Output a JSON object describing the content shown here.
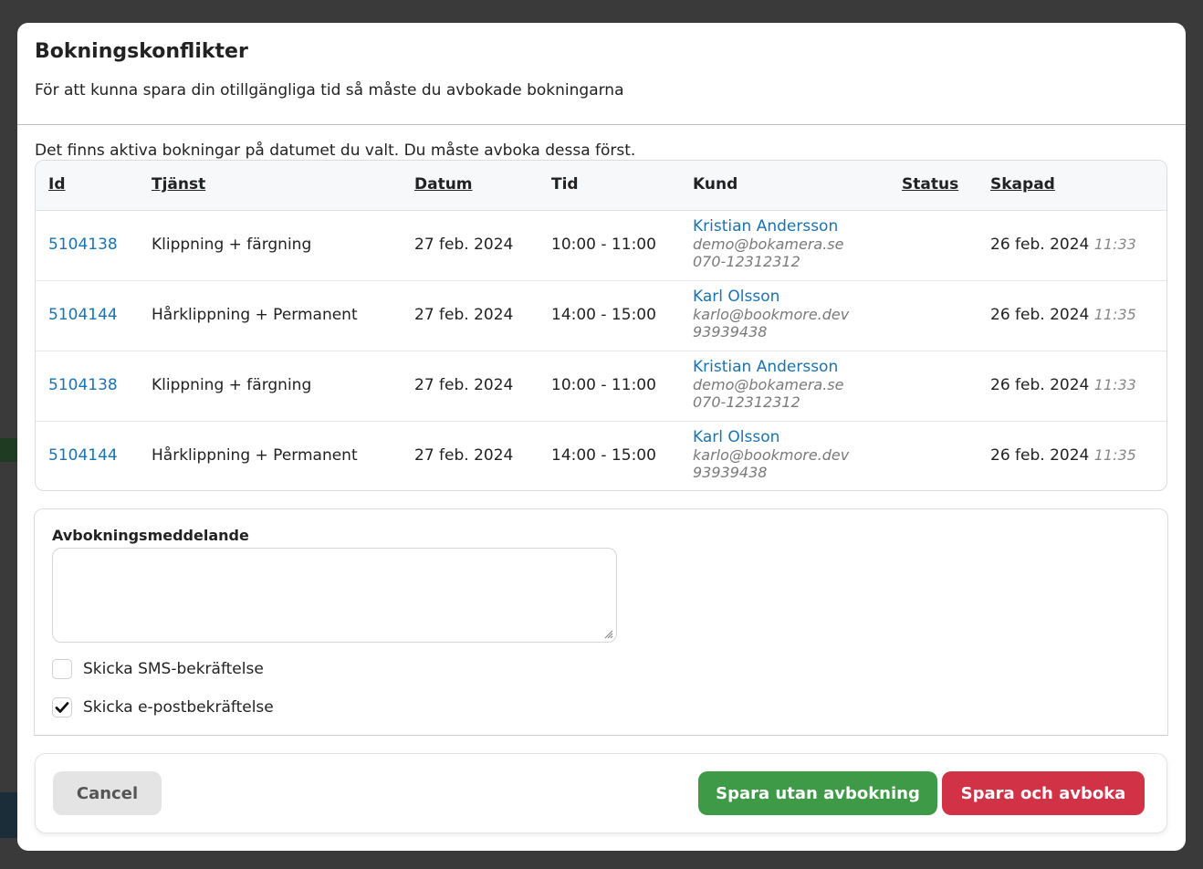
{
  "modal": {
    "title": "Bokningskonflikter",
    "subtitle": "För att kunna spara din otillgängliga tid så måste du avbokade bokningarna",
    "notice": "Det finns aktiva bokningar på datumet du valt. Du måste avboka dessa först."
  },
  "table": {
    "headers": {
      "id": "Id",
      "service": "Tjänst",
      "date": "Datum",
      "time": "Tid",
      "customer": "Kund",
      "status": "Status",
      "created": "Skapad"
    },
    "rows": [
      {
        "id": "5104138",
        "service": "Klippning + färgning",
        "date": "27 feb. 2024",
        "time": "10:00 - 11:00",
        "customer_name": "Kristian Andersson",
        "customer_email": "demo@bokamera.se",
        "customer_phone": "070-12312312",
        "status": "",
        "created_date": "26 feb. 2024",
        "created_time": "11:33"
      },
      {
        "id": "5104144",
        "service": "Hårklippning + Permanent",
        "date": "27 feb. 2024",
        "time": "14:00 - 15:00",
        "customer_name": "Karl Olsson",
        "customer_email": "karlo@bookmore.dev",
        "customer_phone": "93939438",
        "status": "",
        "created_date": "26 feb. 2024",
        "created_time": "11:35"
      },
      {
        "id": "5104138",
        "service": "Klippning + färgning",
        "date": "27 feb. 2024",
        "time": "10:00 - 11:00",
        "customer_name": "Kristian Andersson",
        "customer_email": "demo@bokamera.se",
        "customer_phone": "070-12312312",
        "status": "",
        "created_date": "26 feb. 2024",
        "created_time": "11:33"
      },
      {
        "id": "5104144",
        "service": "Hårklippning + Permanent",
        "date": "27 feb. 2024",
        "time": "14:00 - 15:00",
        "customer_name": "Karl Olsson",
        "customer_email": "karlo@bookmore.dev",
        "customer_phone": "93939438",
        "status": "",
        "created_date": "26 feb. 2024",
        "created_time": "11:35"
      }
    ]
  },
  "form": {
    "message_label": "Avbokningsmeddelande",
    "message_value": "",
    "sms_label": "Skicka SMS-bekräftelse",
    "sms_checked": false,
    "email_label": "Skicka e-postbekräftelse",
    "email_checked": true
  },
  "footer": {
    "cancel_label": "Cancel",
    "save_without_label": "Spara utan avbokning",
    "save_and_cancel_label": "Spara och avboka"
  },
  "colors": {
    "link": "#1a73b0",
    "green": "#3f9a48",
    "red": "#d23246",
    "cancel_bg": "#e4e4e4"
  },
  "icons": {
    "checkmark": "check-icon",
    "resize": "resize-grip-icon"
  }
}
